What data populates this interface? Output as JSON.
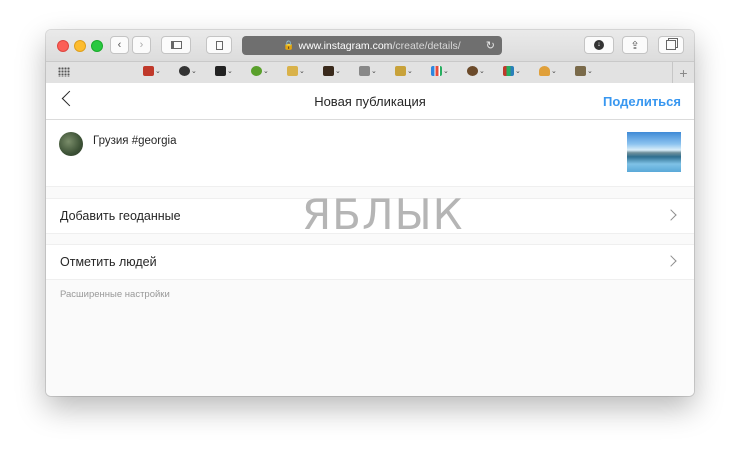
{
  "browser": {
    "url_host": "www.instagram.com",
    "url_path": "/create/details/",
    "bookmarks": [
      "car",
      "soccer",
      "film",
      "apple",
      "island",
      "briefcase",
      "cart",
      "money",
      "chart",
      "spy",
      "books",
      "meditation",
      "home"
    ]
  },
  "instagram": {
    "header": {
      "title": "Новая публикация",
      "share_label": "Поделиться"
    },
    "post": {
      "caption": "Грузия #georgia"
    },
    "options": [
      {
        "label": "Добавить геоданные"
      },
      {
        "label": "Отметить людей"
      }
    ],
    "advanced_label": "Расширенные настройки"
  },
  "watermark": "ЯБЛЫК",
  "colors": {
    "accent": "#3897f0",
    "text": "#262626",
    "muted": "#999999"
  }
}
